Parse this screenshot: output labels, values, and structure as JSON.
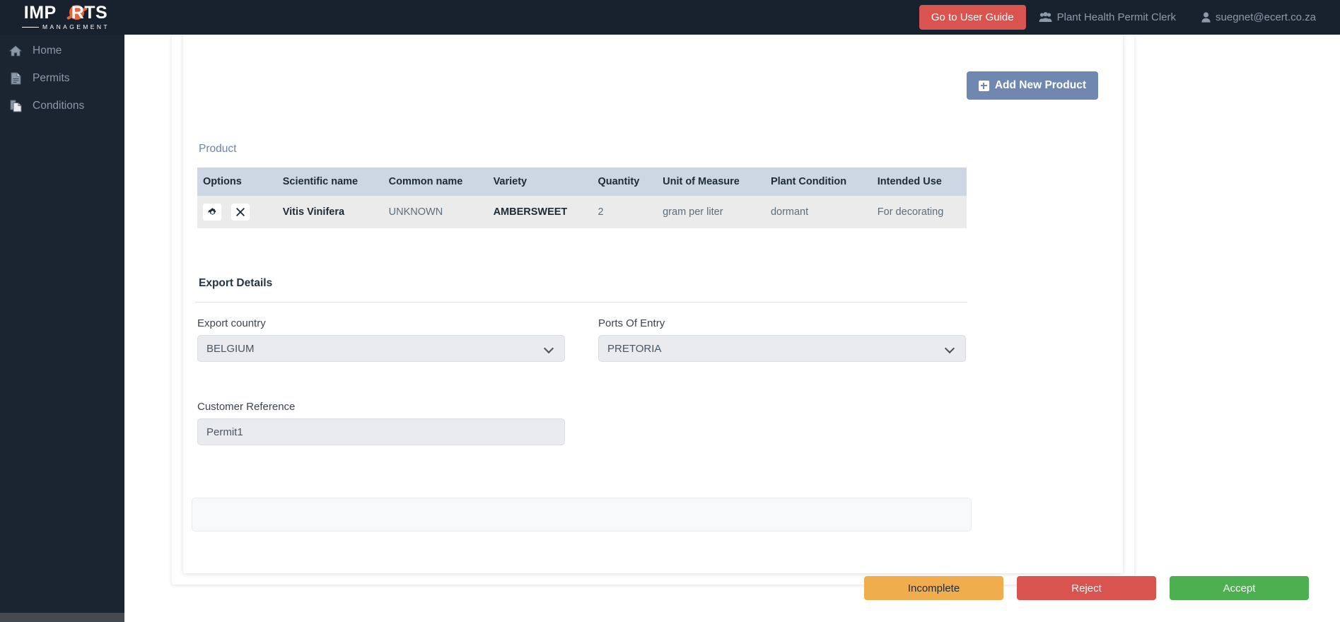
{
  "brand": {
    "main": "IMP RTS",
    "main_pre": "IMP",
    "main_post": "RTS",
    "sub": "MANAGEMENT"
  },
  "topbar": {
    "user_guide_label": "Go to User Guide",
    "role_label": "Plant Health Permit Clerk",
    "user_email": "suegnet@ecert.co.za",
    "role_icon": "users-icon",
    "user_icon": "user-icon",
    "accent_red": "#d9534f",
    "background": "#18222f"
  },
  "sidebar": {
    "background": "#1b2431",
    "items": [
      {
        "label": "Home",
        "icon": "home-icon"
      },
      {
        "label": "Permits",
        "icon": "document-icon"
      },
      {
        "label": "Conditions",
        "icon": "documents-icon"
      }
    ]
  },
  "main": {
    "add_product_button": {
      "label": "Add New Product",
      "icon": "plus-square-icon",
      "color": "#7088b0"
    },
    "product_section_label": "Product",
    "product_table": {
      "columns": [
        "Options",
        "Scientific name",
        "Common name",
        "Variety",
        "Quantity",
        "Unit of Measure",
        "Plant Condition",
        "Intended Use"
      ],
      "rows": [
        {
          "options": [
            "settings-icon",
            "remove-icon"
          ],
          "scientific_name": "Vitis Vinifera",
          "common_name": "UNKNOWN",
          "variety": "AMBERSWEET",
          "quantity": "2",
          "unit_of_measure": "gram per liter",
          "plant_condition": "dormant",
          "intended_use": "For decorating"
        }
      ]
    },
    "export_details": {
      "title": "Export Details",
      "export_country": {
        "label": "Export country",
        "value": "BELGIUM"
      },
      "ports_of_entry": {
        "label": "Ports Of Entry",
        "value": "PRETORIA"
      },
      "customer_reference": {
        "label": "Customer Reference",
        "value": "Permit1"
      }
    }
  },
  "footer": {
    "incomplete_label": "Incomplete",
    "reject_label": "Reject",
    "accept_label": "Accept",
    "incomplete_color": "#f0ad4e",
    "reject_color": "#d9534f",
    "accept_color": "#4caf50"
  }
}
